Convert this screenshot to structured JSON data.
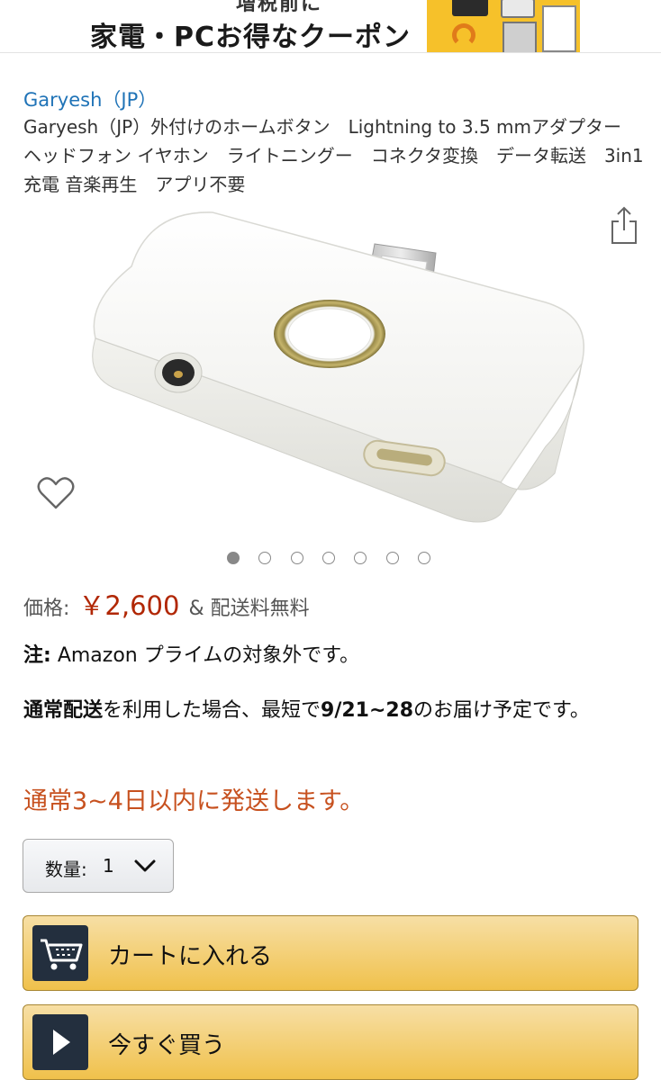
{
  "banner": {
    "top_text": "増税前に",
    "main_text": "家電・PCお得なクーポン"
  },
  "product": {
    "brand": "Garyesh（JP）",
    "title": "Garyesh（JP）外付けのホームボタン　Lightning to 3.5 mmアダプター　ヘッドフォン イヤホン　ライトニングー　コネクタ変換　データ転送　3in1充電 音楽再生　アプリ不要"
  },
  "gallery": {
    "image_count": 7,
    "active_index": 0
  },
  "price": {
    "label": "価格:",
    "value": "￥2,600",
    "amp": "&",
    "shipping": "配送料無料"
  },
  "note": {
    "label": "注:",
    "text": "Amazon プライムの対象外です。"
  },
  "delivery": {
    "bold1": "通常配送",
    "text1": "を利用した場合、最短で",
    "bold2": "9/21~28",
    "text2": "のお届け予定です。"
  },
  "ship_text": "通常3~4日以内に発送します。",
  "quantity": {
    "label": "数量:",
    "value": "1"
  },
  "buttons": {
    "cart_label": "カートに入れる",
    "buy_label": "今すぐ買う"
  },
  "colors": {
    "link": "#1f73b7",
    "price": "#b12704",
    "ship": "#c7511f",
    "button_yellow": "#f0c14b",
    "icon_dark": "#232f3e"
  }
}
